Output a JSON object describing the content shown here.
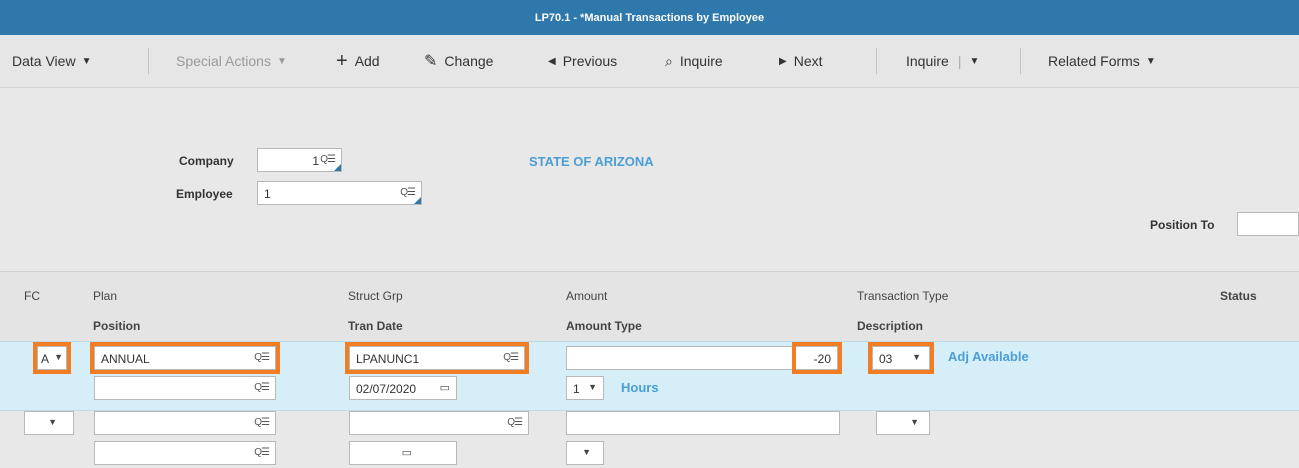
{
  "window": {
    "title": "LP70.1 - *Manual Transactions by Employee"
  },
  "toolbar": {
    "data_view": "Data View",
    "special_actions": "Special Actions",
    "add": "Add",
    "change": "Change",
    "previous": "Previous",
    "inquire_btn": "Inquire",
    "next": "Next",
    "inquire_menu": "Inquire",
    "related_forms": "Related Forms"
  },
  "header": {
    "company_label": "Company",
    "company_value": "1",
    "company_name": "STATE OF ARIZONA",
    "employee_label": "Employee",
    "employee_value": "1",
    "position_to_label": "Position To",
    "position_to_value": ""
  },
  "grid": {
    "columns": {
      "fc": "FC",
      "plan": "Plan",
      "position": "Position",
      "struct_grp": "Struct Grp",
      "tran_date": "Tran Date",
      "amount": "Amount",
      "amount_type": "Amount Type",
      "transaction_type": "Transaction Type",
      "description": "Description",
      "status": "Status"
    },
    "rows": [
      {
        "fc": "A",
        "plan": "ANNUAL",
        "position": "",
        "struct_grp": "LPANUNC1",
        "tran_date": "02/07/2020",
        "amount": "-20",
        "amount_type": "1",
        "amount_type_desc": "Hours",
        "transaction_type": "03",
        "description": "Adj Available"
      },
      {
        "fc": "",
        "plan": "",
        "position": "",
        "struct_grp": "",
        "tran_date": "",
        "amount": "",
        "amount_type": "",
        "transaction_type": ""
      }
    ]
  },
  "colors": {
    "title_bar": "#2e78ab",
    "highlight": "#f27d22",
    "selected_row": "#d5eef8",
    "link": "#4a9fd5"
  }
}
